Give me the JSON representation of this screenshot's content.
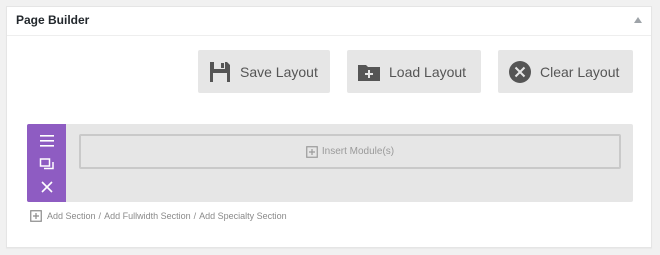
{
  "panel": {
    "title": "Page Builder",
    "collapse_icon": "collapse-arrow-icon"
  },
  "layout_buttons": {
    "save": {
      "label": "Save Layout",
      "icon": "save-icon"
    },
    "load": {
      "label": "Load Layout",
      "icon": "load-icon"
    },
    "clear": {
      "label": "Clear Layout",
      "icon": "clear-icon"
    }
  },
  "section": {
    "handle_color": "#8e5cc2",
    "handle_icons": [
      "menu-icon",
      "duplicate-icon",
      "close-icon"
    ],
    "insert_label": "Insert Module(s)"
  },
  "add_links": {
    "section": "Add Section",
    "fullwidth": "Add Fullwidth Section",
    "specialty": "Add Specialty Section",
    "separator": "/"
  }
}
